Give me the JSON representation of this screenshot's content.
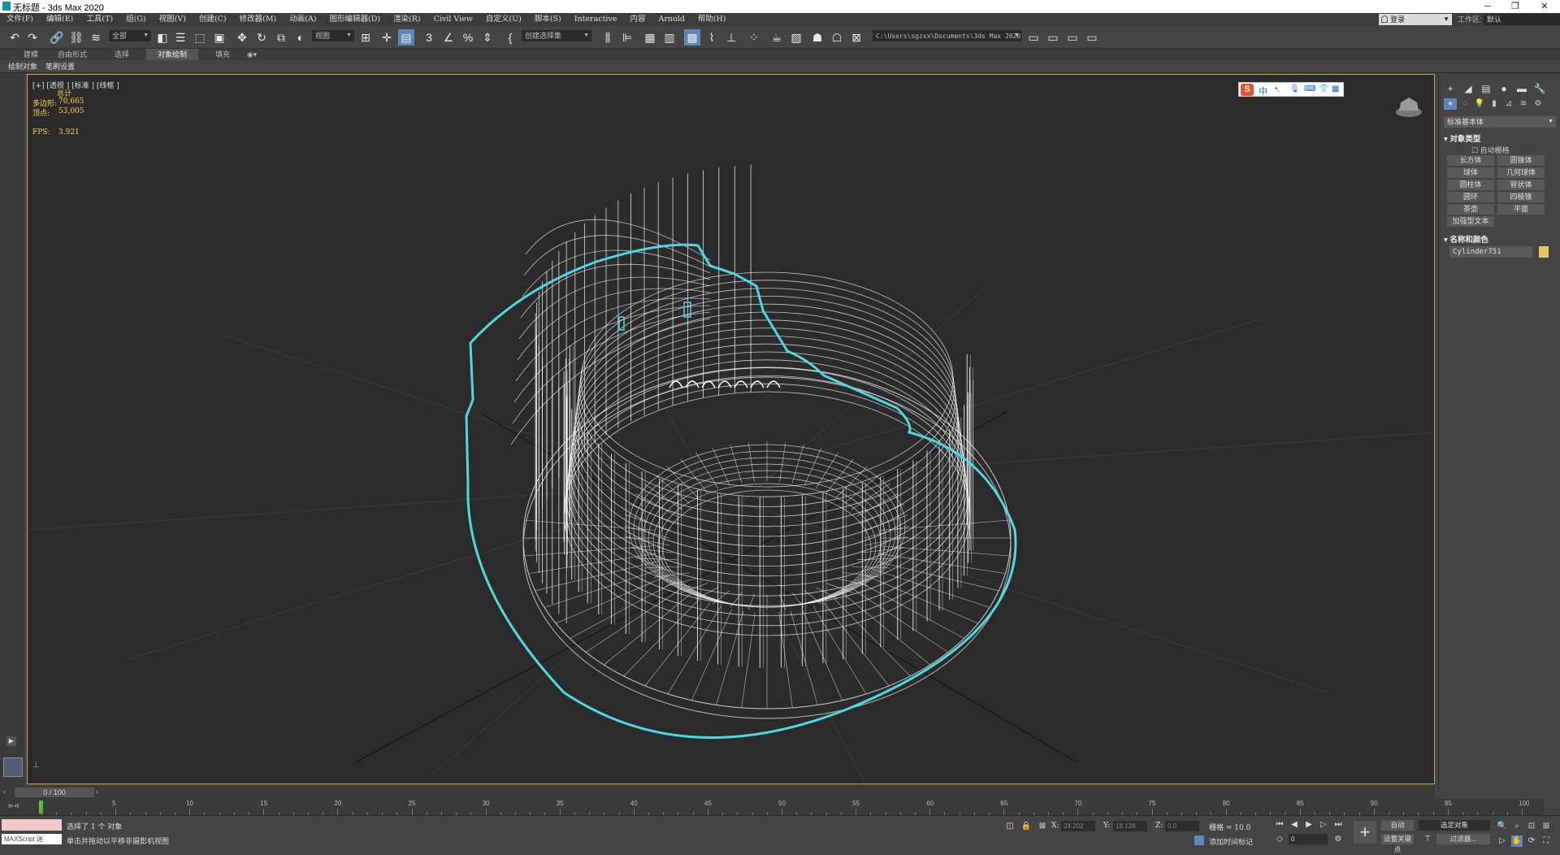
{
  "window": {
    "title": "无标题 - 3ds Max 2020"
  },
  "menu": [
    "文件(F)",
    "编辑(E)",
    "工具(T)",
    "组(G)",
    "视图(V)",
    "创建(C)",
    "修改器(M)",
    "动画(A)",
    "图形编辑器(D)",
    "渲染(R)",
    "Civil View",
    "自定义(U)",
    "脚本(S)",
    "Interactive",
    "内容",
    "Arnold",
    "帮助(H)"
  ],
  "account": {
    "login": "登录",
    "workspace_label": "工作区:",
    "workspace_value": "默认"
  },
  "toolbar": {
    "filter_value": "全部",
    "refcoord_value": "视图",
    "selection_set_placeholder": "创建选择集",
    "project_path": "C:\\Users\\sgzxx\\Documents\\3ds Max 2020"
  },
  "ribbon": {
    "tabs": [
      "建模",
      "自由形式",
      "选择",
      "对象绘制",
      "填充"
    ],
    "active": "对象绘制"
  },
  "subbar": {
    "items": [
      "绘制对象",
      "笔刷设置"
    ]
  },
  "viewport": {
    "label": "[+] [透视 ] [标准 ] [线框 ]",
    "stats_header": "总计",
    "polygons_label": "多边形:",
    "polygons_value": "70,665",
    "vertices_label": "顶点:",
    "vertices_value": "53,005",
    "fps_label": "FPS:",
    "fps_value": "3.921",
    "ime_text": "中"
  },
  "command_panel": {
    "dropdown": "标准基本体",
    "section_object_type": "对象类型",
    "autogrid": "自动栅格",
    "buttons": [
      "长方体",
      "圆锥体",
      "球体",
      "几何球体",
      "圆柱体",
      "管状体",
      "圆环",
      "四棱锥",
      "茶壶",
      "平面",
      "加强型文本"
    ],
    "section_name_color": "名称和颜色",
    "object_name": "Cylinder751",
    "object_color": "#e4c860"
  },
  "timeline": {
    "frame_display": "0 / 100",
    "ticks": [
      "5",
      "10",
      "15",
      "20",
      "25",
      "30",
      "35",
      "40",
      "45",
      "50",
      "55",
      "60",
      "65",
      "70",
      "75",
      "80",
      "85",
      "90",
      "95",
      "100"
    ]
  },
  "status": {
    "maxscript_label": "MAXScript 迷",
    "selected": "选择了 1 个 对象",
    "prompt": "单击并拖动以平移非摄影机视图",
    "x_label": "X:",
    "x_value": "24.202",
    "y_label": "Y:",
    "y_value": "18.128",
    "z_label": "Z:",
    "z_value": "0.0",
    "grid": "栅格 = 10.0",
    "add_time_tag": "添加时间标记",
    "auto_key": "自动",
    "key_mode": "选定对象",
    "set_key": "设置关键点",
    "key_filters": "过滤器...",
    "frame_value": "0"
  },
  "colors": {
    "selection_outline": "#4fd8e0",
    "wire": "#ffffff",
    "viewport_border": "#c2a54f"
  }
}
